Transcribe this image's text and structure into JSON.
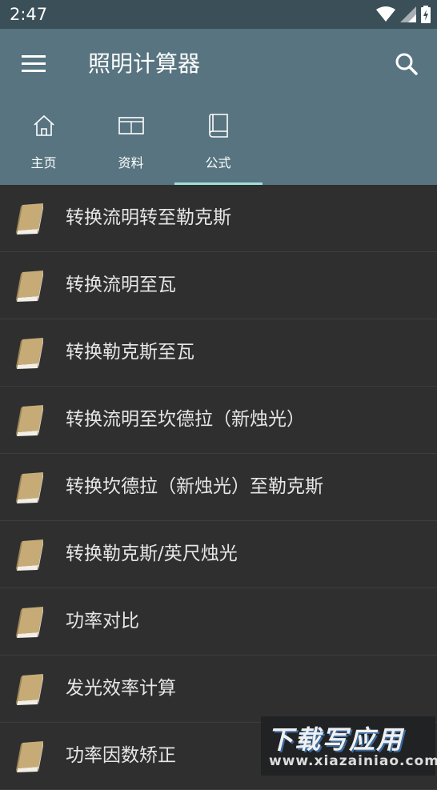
{
  "status_bar": {
    "time": "2:47"
  },
  "app_bar": {
    "title": "照明计算器"
  },
  "tabs": [
    {
      "label": "主页",
      "icon": "home-icon"
    },
    {
      "label": "资料",
      "icon": "table-icon"
    },
    {
      "label": "公式",
      "icon": "book-icon",
      "selected": true
    }
  ],
  "formulas": [
    {
      "label": "转换流明转至勒克斯"
    },
    {
      "label": "转换流明至瓦"
    },
    {
      "label": "转换勒克斯至瓦"
    },
    {
      "label": "转换流明至坎德拉（新烛光）"
    },
    {
      "label": "转换坎德拉（新烛光）至勒克斯"
    },
    {
      "label": "转换勒克斯/英尺烛光"
    },
    {
      "label": "功率对比"
    },
    {
      "label": "发光效率计算"
    },
    {
      "label": "功率因数矫正"
    }
  ],
  "watermark": {
    "title": "下载写应用",
    "url": "www.xiazainiao.com"
  },
  "colors": {
    "app_bar": "#577480",
    "status_bar": "#3a4f57",
    "list_bg": "#2f2f2f",
    "indicator": "#9fe0d9"
  }
}
